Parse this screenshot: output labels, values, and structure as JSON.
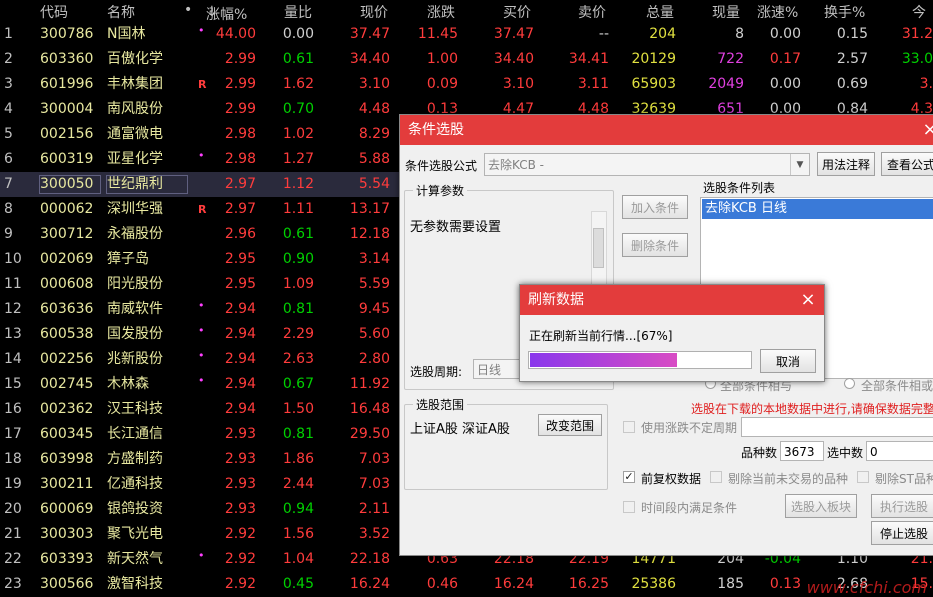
{
  "table": {
    "headers": [
      "代码",
      "名称",
      "•",
      "涨幅%",
      "量比",
      "现价",
      "涨跌",
      "买价",
      "卖价",
      "总量",
      "现量",
      "涨速%",
      "换手%",
      "今"
    ],
    "sort_arrow": "↓",
    "rows": [
      {
        "n": "1",
        "code": "300786",
        "name": "N国林",
        "flag": "",
        "dot": "•",
        "pct": "44.00",
        "lb": "0.00",
        "price": "37.47",
        "chg": "11.45",
        "bid": "37.47",
        "ask": "--",
        "vol": "204",
        "cur": "8",
        "spd": "0.00",
        "turn": "0.15",
        "today": "31.2"
      },
      {
        "n": "2",
        "code": "603360",
        "name": "百傲化学",
        "flag": "",
        "dot": "",
        "pct": "2.99",
        "lb": "0.61",
        "price": "34.40",
        "chg": "1.00",
        "bid": "34.40",
        "ask": "34.41",
        "vol": "20129",
        "cur": "722",
        "spd": "0.17",
        "turn": "2.57",
        "today": "33.0"
      },
      {
        "n": "3",
        "code": "601996",
        "name": "丰林集团",
        "flag": "R",
        "dot": "•",
        "pct": "2.99",
        "lb": "1.62",
        "price": "3.10",
        "chg": "0.09",
        "bid": "3.10",
        "ask": "3.11",
        "vol": "65903",
        "cur": "2049",
        "spd": "0.00",
        "turn": "0.69",
        "today": "3."
      },
      {
        "n": "4",
        "code": "300004",
        "name": "南风股份",
        "flag": "",
        "dot": "",
        "pct": "2.99",
        "lb": "0.70",
        "price": "4.48",
        "chg": "0.13",
        "bid": "4.47",
        "ask": "4.48",
        "vol": "32639",
        "cur": "651",
        "spd": "0.00",
        "turn": "0.84",
        "today": "4.3"
      },
      {
        "n": "5",
        "code": "002156",
        "name": "通富微电",
        "flag": "",
        "dot": "",
        "pct": "2.98",
        "lb": "1.02",
        "price": "8.29",
        "chg": "",
        "bid": "",
        "ask": "",
        "vol": "",
        "cur": "",
        "spd": "",
        "turn": "",
        "today": ""
      },
      {
        "n": "6",
        "code": "600319",
        "name": "亚星化学",
        "flag": "",
        "dot": "•",
        "pct": "2.98",
        "lb": "1.27",
        "price": "5.88",
        "chg": "",
        "bid": "",
        "ask": "",
        "vol": "",
        "cur": "",
        "spd": "",
        "turn": "",
        "today": ""
      },
      {
        "n": "7",
        "code": "300050",
        "name": "世纪鼎利",
        "flag": "",
        "dot": "",
        "pct": "2.97",
        "lb": "1.12",
        "price": "5.54",
        "chg": "",
        "bid": "",
        "ask": "",
        "vol": "",
        "cur": "",
        "spd": "",
        "turn": "",
        "today": ""
      },
      {
        "n": "8",
        "code": "000062",
        "name": "深圳华强",
        "flag": "R",
        "dot": "",
        "pct": "2.97",
        "lb": "1.11",
        "price": "13.17",
        "chg": "",
        "bid": "",
        "ask": "",
        "vol": "",
        "cur": "",
        "spd": "",
        "turn": "",
        "today": ""
      },
      {
        "n": "9",
        "code": "300712",
        "name": "永福股份",
        "flag": "",
        "dot": "",
        "pct": "2.96",
        "lb": "0.61",
        "price": "12.18",
        "chg": "",
        "bid": "",
        "ask": "",
        "vol": "",
        "cur": "",
        "spd": "",
        "turn": "",
        "today": ""
      },
      {
        "n": "10",
        "code": "002069",
        "name": "獐子岛",
        "flag": "",
        "dot": "",
        "pct": "2.95",
        "lb": "0.90",
        "price": "3.14",
        "chg": "",
        "bid": "",
        "ask": "",
        "vol": "",
        "cur": "",
        "spd": "",
        "turn": "",
        "today": ""
      },
      {
        "n": "11",
        "code": "000608",
        "name": "阳光股份",
        "flag": "",
        "dot": "",
        "pct": "2.95",
        "lb": "1.09",
        "price": "5.59",
        "chg": "",
        "bid": "",
        "ask": "",
        "vol": "",
        "cur": "",
        "spd": "",
        "turn": "",
        "today": ""
      },
      {
        "n": "12",
        "code": "603636",
        "name": "南威软件",
        "flag": "",
        "dot": "•",
        "pct": "2.94",
        "lb": "0.81",
        "price": "9.45",
        "chg": "",
        "bid": "",
        "ask": "",
        "vol": "",
        "cur": "",
        "spd": "",
        "turn": "",
        "today": ""
      },
      {
        "n": "13",
        "code": "600538",
        "name": "国发股份",
        "flag": "",
        "dot": "•",
        "pct": "2.94",
        "lb": "2.29",
        "price": "5.60",
        "chg": "",
        "bid": "",
        "ask": "",
        "vol": "",
        "cur": "",
        "spd": "",
        "turn": "",
        "today": ""
      },
      {
        "n": "14",
        "code": "002256",
        "name": "兆新股份",
        "flag": "",
        "dot": "•",
        "pct": "2.94",
        "lb": "2.63",
        "price": "2.80",
        "chg": "",
        "bid": "",
        "ask": "",
        "vol": "",
        "cur": "",
        "spd": "",
        "turn": "",
        "today": ""
      },
      {
        "n": "15",
        "code": "002745",
        "name": "木林森",
        "flag": "",
        "dot": "•",
        "pct": "2.94",
        "lb": "0.67",
        "price": "11.92",
        "chg": "",
        "bid": "",
        "ask": "",
        "vol": "",
        "cur": "",
        "spd": "",
        "turn": "",
        "today": ""
      },
      {
        "n": "16",
        "code": "002362",
        "name": "汉王科技",
        "flag": "",
        "dot": "",
        "pct": "2.94",
        "lb": "1.50",
        "price": "16.48",
        "chg": "",
        "bid": "",
        "ask": "",
        "vol": "",
        "cur": "",
        "spd": "",
        "turn": "",
        "today": ""
      },
      {
        "n": "17",
        "code": "600345",
        "name": "长江通信",
        "flag": "",
        "dot": "",
        "pct": "2.93",
        "lb": "0.81",
        "price": "29.50",
        "chg": "",
        "bid": "",
        "ask": "",
        "vol": "",
        "cur": "",
        "spd": "",
        "turn": "",
        "today": ""
      },
      {
        "n": "18",
        "code": "603998",
        "name": "方盛制药",
        "flag": "",
        "dot": "",
        "pct": "2.93",
        "lb": "1.86",
        "price": "7.03",
        "chg": "",
        "bid": "",
        "ask": "",
        "vol": "",
        "cur": "",
        "spd": "",
        "turn": "",
        "today": ""
      },
      {
        "n": "19",
        "code": "300211",
        "name": "亿通科技",
        "flag": "",
        "dot": "",
        "pct": "2.93",
        "lb": "2.44",
        "price": "7.03",
        "chg": "",
        "bid": "",
        "ask": "",
        "vol": "",
        "cur": "",
        "spd": "",
        "turn": "",
        "today": ""
      },
      {
        "n": "20",
        "code": "600069",
        "name": "银鸽投资",
        "flag": "",
        "dot": "",
        "pct": "2.93",
        "lb": "0.94",
        "price": "2.11",
        "chg": "",
        "bid": "",
        "ask": "",
        "vol": "",
        "cur": "",
        "spd": "",
        "turn": "",
        "today": ""
      },
      {
        "n": "21",
        "code": "300303",
        "name": "聚飞光电",
        "flag": "",
        "dot": "",
        "pct": "2.92",
        "lb": "1.56",
        "price": "3.52",
        "chg": "",
        "bid": "",
        "ask": "",
        "vol": "",
        "cur": "",
        "spd": "",
        "turn": "",
        "today": ""
      },
      {
        "n": "22",
        "code": "603393",
        "name": "新天然气",
        "flag": "",
        "dot": "•",
        "pct": "2.92",
        "lb": "1.04",
        "price": "22.18",
        "chg": "0.63",
        "bid": "22.18",
        "ask": "22.19",
        "vol": "14771",
        "cur": "204",
        "spd": "-0.04",
        "turn": "1.10",
        "today": "21."
      },
      {
        "n": "23",
        "code": "300566",
        "name": "激智科技",
        "flag": "",
        "dot": "",
        "pct": "2.92",
        "lb": "0.45",
        "price": "16.24",
        "chg": "0.46",
        "bid": "16.24",
        "ask": "16.25",
        "vol": "25386",
        "cur": "185",
        "spd": "0.13",
        "turn": "2.68",
        "today": "15."
      }
    ]
  },
  "dialog": {
    "title": "条件选股",
    "close_icon": "×",
    "formula_label": "条件选股公式",
    "formula_value": "去除KCB    -",
    "usage_btn": "用法注释",
    "view_formula_btn": "查看公式",
    "params_title": "计算参数",
    "params_text": "无参数需要设置",
    "period_label": "选股周期:",
    "period_value": "日线",
    "add_btn": "加入条件",
    "del_btn": "删除条件",
    "list_title": "选股条件列表",
    "list_items": [
      "去除KCB  日线"
    ],
    "radio_all_and": "全部条件相与",
    "radio_all_or": "全部条件相或",
    "warning": "选股在下载的本地数据中进行,请确保数据完整",
    "scope_title": "选股范围",
    "scope_text": "上证A股 深证A股",
    "change_scope_btn": "改变范围",
    "use_period_chk": "使用涨跌不定周期",
    "count_label": "品种数",
    "count_value": "3673",
    "selected_label": "选中数",
    "selected_value": "0",
    "adjusted_chk": "前复权数据",
    "remove_untraded_chk": "剔除当前未交易的品种",
    "remove_st_chk": "剔除ST品种",
    "time_period_chk": "时间段内满足条件",
    "to_block_btn": "选股入板块",
    "exec_btn": "执行选股",
    "stop_btn": "停止选股"
  },
  "progress": {
    "title": "刷新数据",
    "message": "正在刷新当前行情...[67%]",
    "percent": 67,
    "cancel_btn": "取消"
  },
  "watermark": "www.cfchi.com"
}
